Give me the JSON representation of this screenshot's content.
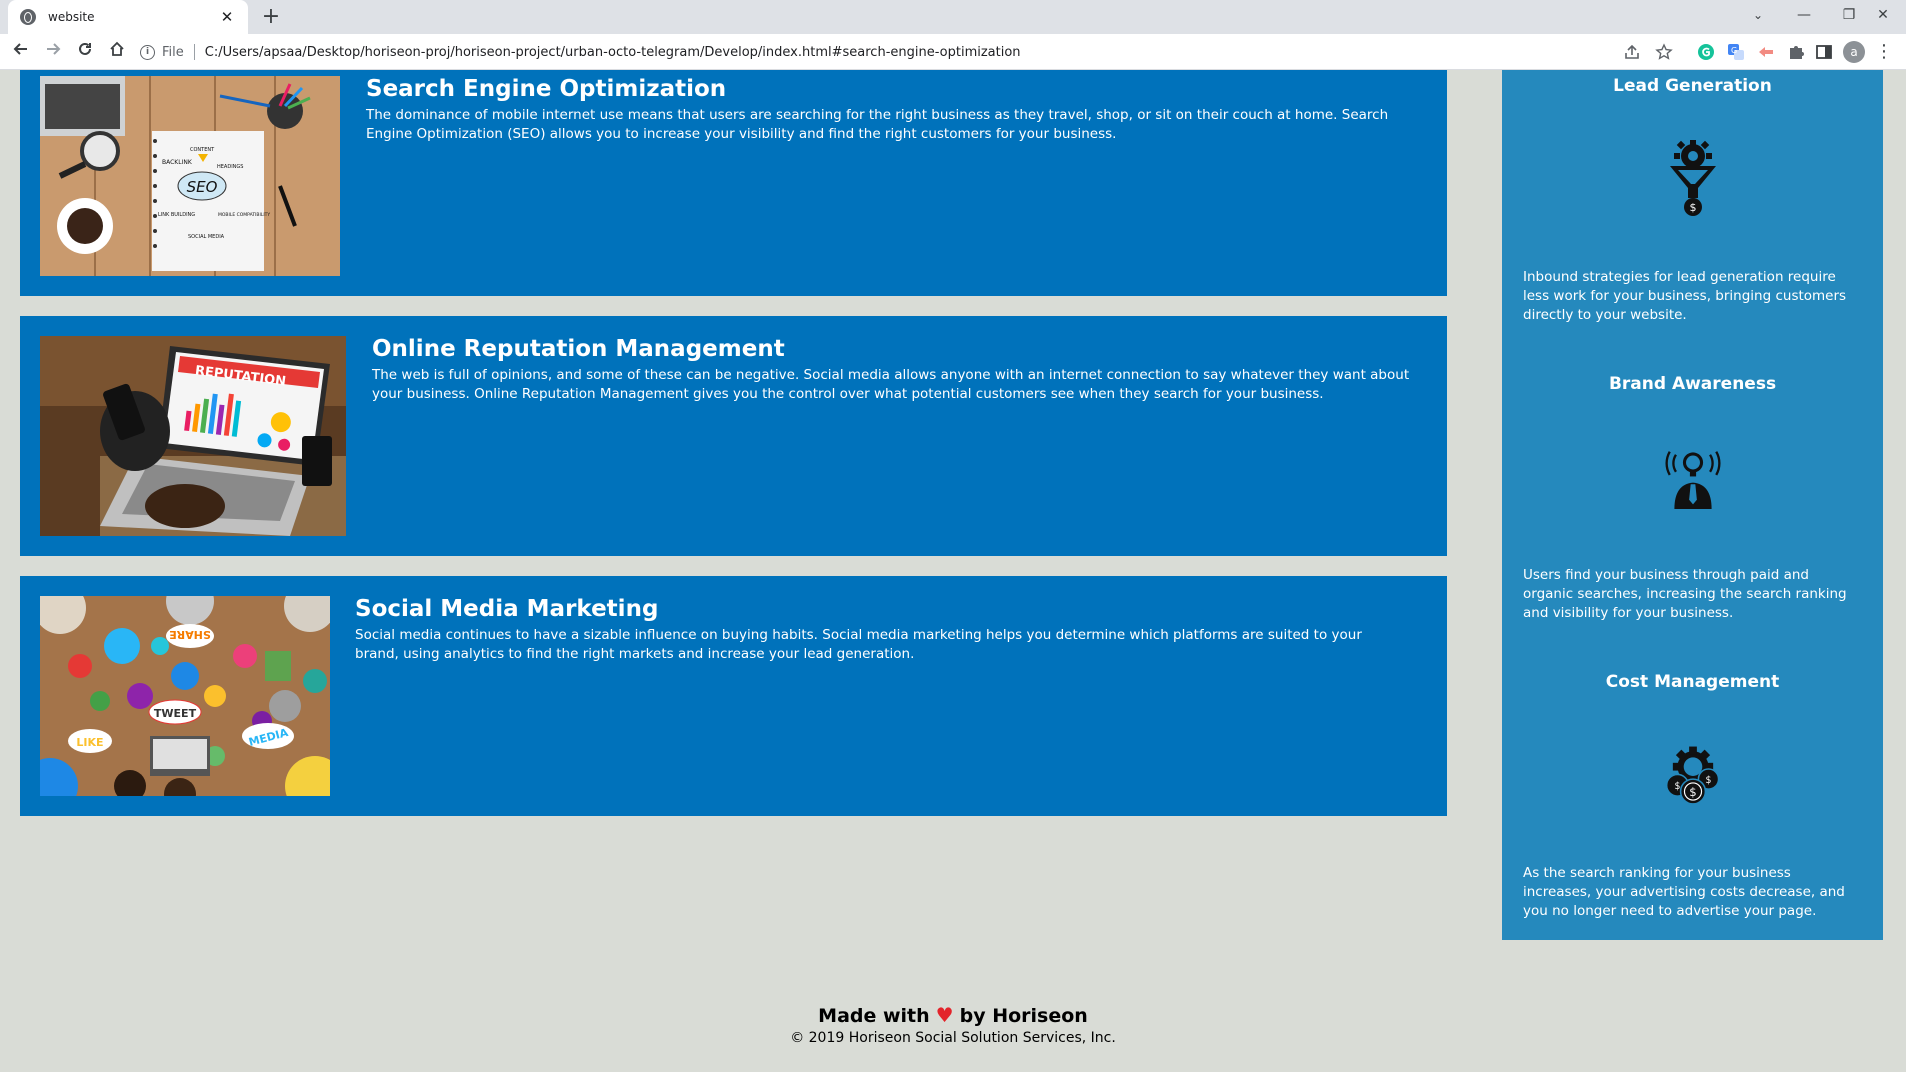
{
  "browser": {
    "tab_title": "website",
    "tab_close": "✕",
    "new_tab": "+",
    "scheme": "File",
    "url": "C:/Users/apsaa/Desktop/horiseon-proj/horiseon-project/urban-octo-telegram/Develop/index.html#search-engine-optimization",
    "profile_initial": "a"
  },
  "sections": [
    {
      "title": "Search Engine Optimization",
      "body": "The dominance of mobile internet use means that users are searching for the right business as they travel, shop, or sit on their couch at home. Search Engine Optimization (SEO) allows you to increase your visibility and find the right customers for your business.",
      "image_labels": [
        "SEO",
        "BACKLINK",
        "CONTENT",
        "HEADINGS",
        "LINK BUILDING",
        "MOBILE COMPATIBILITY",
        "SOCIAL MEDIA"
      ]
    },
    {
      "title": "Online Reputation Management",
      "body": "The web is full of opinions, and some of these can be negative. Social media allows anyone with an internet connection to say whatever they want about your business. Online Reputation Management gives you the control over what potential customers see when they search for your business.",
      "image_labels": [
        "REPUTATION"
      ]
    },
    {
      "title": "Social Media Marketing",
      "body": "Social media continues to have a sizable influence on buying habits. Social media marketing helps you determine which platforms are suited to your brand, using analytics to find the right markets and increase your lead generation.",
      "image_labels": [
        "SHARE",
        "TWEET",
        "LIKE",
        "MEDIA"
      ]
    }
  ],
  "benefits": [
    {
      "title": "Lead Generation",
      "icon": "lead-funnel-icon",
      "body": "Inbound strategies for lead generation require less work for your business, bringing customers directly to your website."
    },
    {
      "title": "Brand Awareness",
      "icon": "lightbulb-person-icon",
      "body": "Users find your business through paid and organic searches, increasing the search ranking and visibility for your business."
    },
    {
      "title": "Cost Management",
      "icon": "gear-coins-icon",
      "body": "As the search ranking for your business increases, your advertising costs decrease, and you no longer need to advertise your page."
    }
  ],
  "footer": {
    "made_prefix": "Made with",
    "heart": "♥",
    "made_suffix": "by Horiseon",
    "copyright": "© 2019 Horiseon Social Solution Services, Inc."
  },
  "colors": {
    "card_bg": "#0072bb",
    "aside_bg": "#2589bd",
    "page_bg": "#d9dcd6"
  }
}
